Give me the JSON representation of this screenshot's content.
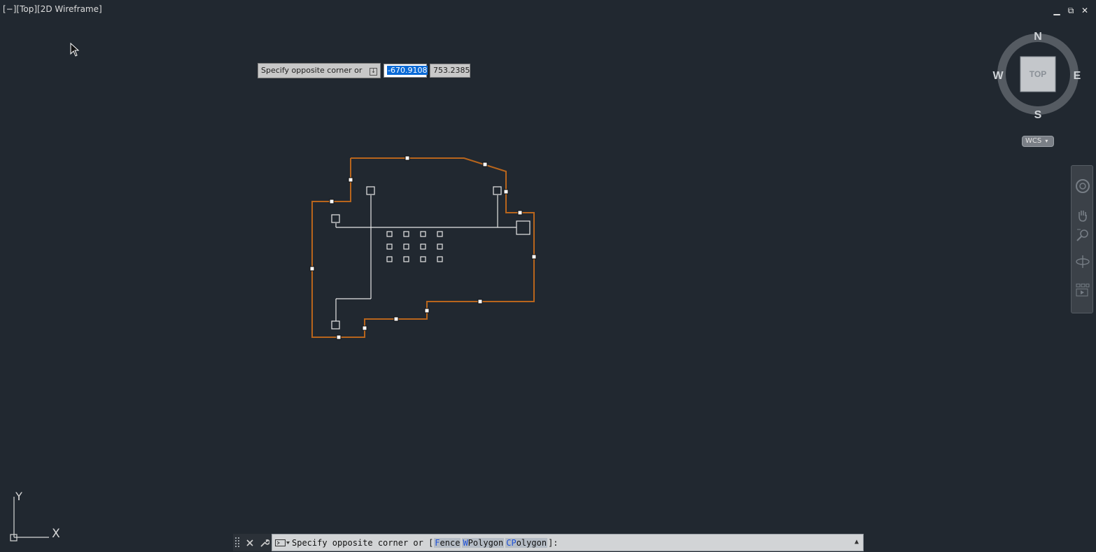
{
  "viewport": {
    "controls": [
      "[−]",
      "[Top]",
      "[2D Wireframe]"
    ],
    "window_buttons": {
      "minimize": "▁",
      "restore": "⧉",
      "close": "✕"
    }
  },
  "dynamic_input": {
    "prompt": "Specify opposite corner or",
    "x_value": "-670.9108",
    "y_value": "753.2385"
  },
  "viewcube": {
    "north": "N",
    "south": "S",
    "east": "E",
    "west": "W",
    "face": "TOP"
  },
  "wcs_label": "WCS",
  "ucs": {
    "x": "X",
    "y": "Y"
  },
  "command_line": {
    "prefix": "Specify opposite corner or [",
    "options": [
      {
        "key": "F",
        "rest": "ence"
      },
      {
        "key": "W",
        "rest": "Polygon"
      },
      {
        "key": "CP",
        "rest": "olygon"
      }
    ],
    "suffix": "]:"
  },
  "colors": {
    "background": "#212830",
    "boundary": "#b8651c",
    "geometry": "#e6e6e6",
    "highlight": "#0a6ad6"
  }
}
